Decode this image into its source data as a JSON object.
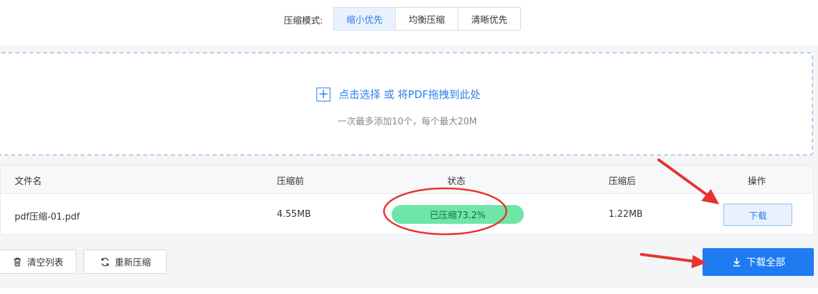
{
  "mode": {
    "label": "压缩模式:",
    "options": [
      "缩小优先",
      "均衡压缩",
      "清晰优先"
    ],
    "selected": "缩小优先"
  },
  "dropzone": {
    "title": "点击选择 或 将PDF拖拽到此处",
    "subtitle": "一次最多添加10个，每个最大20M"
  },
  "table": {
    "headers": [
      "文件名",
      "压缩前",
      "状态",
      "压缩后",
      "操作"
    ],
    "rows": [
      {
        "filename": "pdf压缩-01.pdf",
        "before": "4.55MB",
        "status": "已压缩73.2%",
        "progress_percent": 100,
        "after": "1.22MB",
        "action": "下载"
      }
    ]
  },
  "buttons": {
    "clear": "清空列表",
    "recompress": "重新压缩",
    "download_all": "下载全部"
  },
  "colors": {
    "accent": "#1e7cf0",
    "progress": "#6ee6a8",
    "annotation": "#e8332e"
  },
  "icons": [
    "plus-icon",
    "trash-icon",
    "refresh-icon",
    "download-icon"
  ]
}
